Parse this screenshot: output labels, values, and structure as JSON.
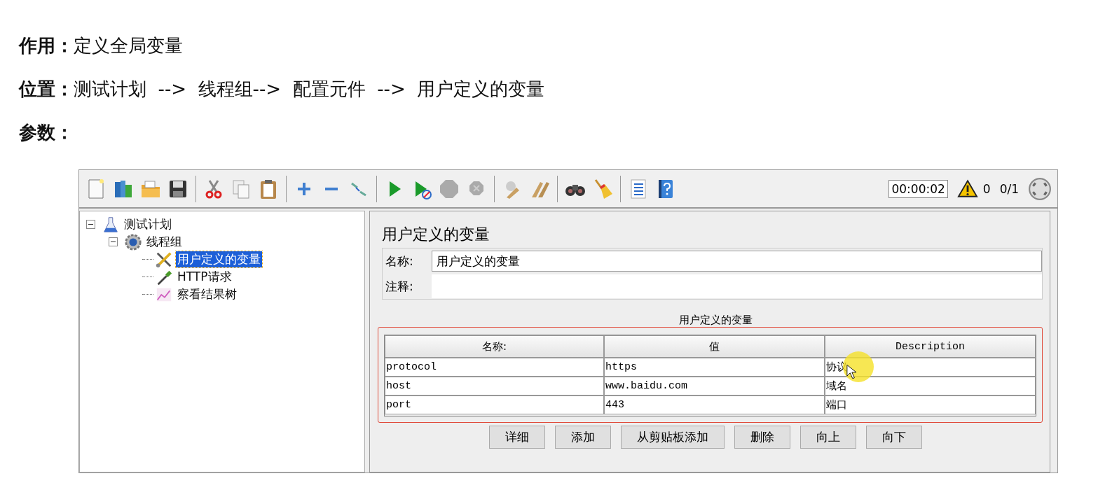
{
  "doc_lines": [
    {
      "label": "作用：",
      "text": "定义全局变量"
    },
    {
      "label": "位置：",
      "text": "测试计划  -->  线程组-->  配置元件  -->  用户定义的变量"
    },
    {
      "label": "参数："
    }
  ],
  "toolbar": {
    "timer": "00:00:02",
    "warning_count": "0",
    "threads": "0/1"
  },
  "tree": [
    {
      "label": "测试计划",
      "kind": "plan",
      "expanded": true,
      "selected": false,
      "children": [
        {
          "label": "线程组",
          "kind": "thread-group",
          "expanded": true,
          "selected": false,
          "children": [
            {
              "label": "用户定义的变量",
              "kind": "config",
              "selected": true
            },
            {
              "label": "HTTP请求",
              "kind": "sampler",
              "selected": false
            },
            {
              "label": "察看结果树",
              "kind": "listener",
              "selected": false
            }
          ]
        }
      ]
    }
  ],
  "panel": {
    "title": "用户定义的变量",
    "name_label": "名称:",
    "name_value": "用户定义的变量",
    "comment_label": "注释:",
    "table": {
      "title": "用户定义的变量",
      "columns": [
        "名称:",
        "值",
        "Description"
      ],
      "rows": [
        [
          "protocol",
          "https",
          "协议"
        ],
        [
          "host",
          "www.baidu.com",
          "域名"
        ],
        [
          "port",
          "443",
          "端口"
        ]
      ]
    },
    "buttons": [
      "详细",
      "添加",
      "从剪贴板添加",
      "删除",
      "向上",
      "向下"
    ]
  }
}
